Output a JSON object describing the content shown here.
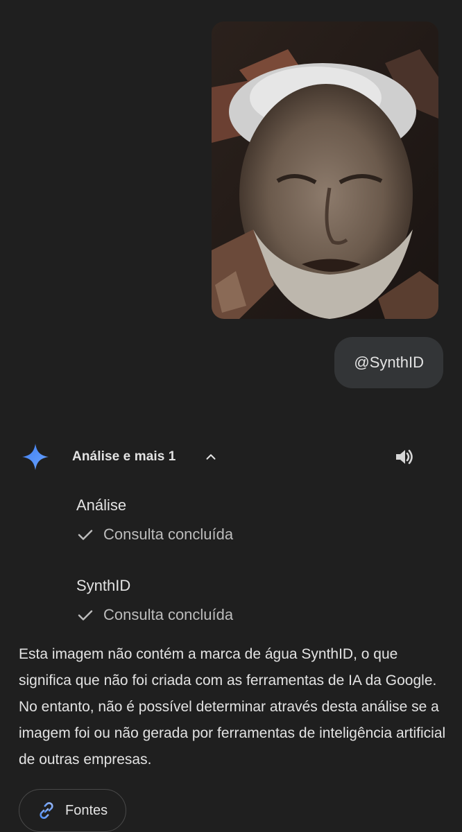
{
  "user_message": {
    "image_icon": "elderly-man-photo",
    "text": "@SynthID"
  },
  "response": {
    "assistant_icon": "gemini-sparkle-icon",
    "tools_summary": "Análise e mais 1",
    "expand_icon": "chevron-up-icon",
    "read_aloud_icon": "speaker-icon",
    "steps": [
      {
        "title": "Análise",
        "status": "Consulta concluída",
        "status_icon": "check-icon"
      },
      {
        "title": "SynthID",
        "status": "Consulta concluída",
        "status_icon": "check-icon"
      }
    ],
    "answer_text": "Esta imagem não contém a marca de água SynthID, o que significa que não foi criada com as ferramentas de IA da Google. No entanto, não é possível determinar através desta análise se a imagem foi ou não gerada por ferramentas de inteligência artificial de outras empresas.",
    "sources_button": {
      "icon": "link-icon",
      "label": "Fontes"
    }
  },
  "colors": {
    "background": "#1f1f1f",
    "bubble": "#333537",
    "text": "#e3e3e3",
    "muted_text": "#bdbdbd",
    "accent": "#4c8df6"
  }
}
